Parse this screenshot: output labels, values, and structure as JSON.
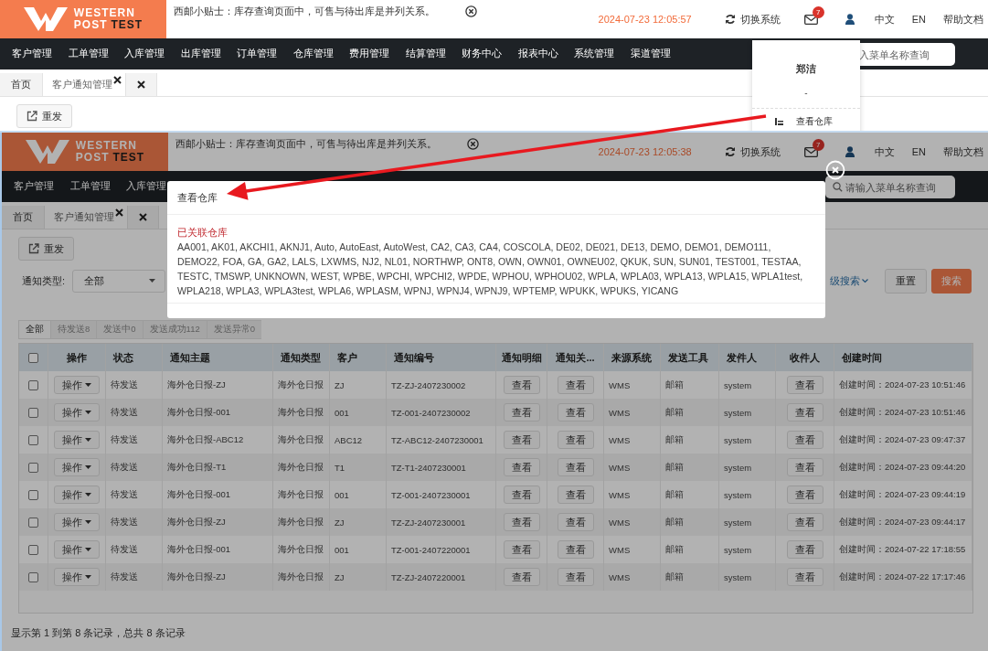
{
  "top_screen": {
    "header": {
      "logo_words": [
        "WESTERN",
        "POST",
        "TEST"
      ],
      "tip": "西邮小贴士：库存查询页面中，可售与待出库是并列关系。",
      "datetime": "2024-07-23 12:05:57",
      "switch_system": "切换系统",
      "mail_badge": "7",
      "languages": [
        "中文",
        "EN"
      ],
      "help": "帮助文档"
    },
    "nav": {
      "items": [
        "客户管理",
        "工单管理",
        "入库管理",
        "出库管理",
        "订单管理",
        "仓库管理",
        "费用管理",
        "结算管理",
        "财务中心",
        "报表中心",
        "系统管理",
        "渠道管理"
      ],
      "search_placeholder": "入菜单名称查询"
    },
    "tabs": [
      {
        "label": "首页",
        "selected": false,
        "closable": false
      },
      {
        "label": "客户通知管理",
        "selected": true,
        "closable": true
      },
      {
        "selected": false,
        "closable": true
      }
    ],
    "resend_button": "重发",
    "user_menu": {
      "name": "郑洁",
      "subtitle": "-",
      "items": [
        "查看仓库"
      ]
    }
  },
  "bottom_screen": {
    "header": {
      "logo_words": [
        "WESTERN",
        "POST",
        "TEST"
      ],
      "tip": "西邮小贴士：库存查询页面中，可售与待出库是并列关系。",
      "datetime": "2024-07-23 12:05:38",
      "switch_system": "切换系统",
      "mail_badge": "7",
      "languages": [
        "中文",
        "EN"
      ],
      "help": "帮助文档"
    },
    "nav": {
      "items": [
        "客户管理",
        "工单管理",
        "入库管理"
      ],
      "search_placeholder": "请输入菜单名称查询"
    },
    "tabs": [
      {
        "label": "首页",
        "selected": false,
        "closable": false
      },
      {
        "label": "客户通知管理",
        "selected": true,
        "closable": true
      },
      {
        "selected": false,
        "closable": true
      }
    ],
    "resend_button": "重发",
    "filter": {
      "label": "通知类型:",
      "value": "全部",
      "advanced_search": "级搜索",
      "reset": "重置",
      "search": "搜索"
    },
    "status_tabs": [
      {
        "label": "全部",
        "selected": true
      },
      {
        "label": "待发送8",
        "selected": false
      },
      {
        "label": "发送中0",
        "selected": false
      },
      {
        "label": "发送成功112",
        "selected": false
      },
      {
        "label": "发送异常0",
        "selected": false
      }
    ],
    "table": {
      "select_all_checked": false,
      "columns": [
        {
          "label": "操作",
          "kind": "menu"
        },
        {
          "label": "状态",
          "kind": "text"
        },
        {
          "label": "通知主题",
          "kind": "text"
        },
        {
          "label": "通知类型",
          "kind": "text"
        },
        {
          "label": "客户",
          "kind": "text"
        },
        {
          "label": "通知编号",
          "kind": "text"
        },
        {
          "label": "通知明细",
          "kind": "button"
        },
        {
          "label": "通知关...",
          "kind": "button"
        },
        {
          "label": "来源系统",
          "kind": "text"
        },
        {
          "label": "发送工具",
          "kind": "text"
        },
        {
          "label": "发件人",
          "kind": "text"
        },
        {
          "label": "收件人",
          "kind": "button"
        },
        {
          "label": "创建时间",
          "kind": "text"
        }
      ],
      "rows": [
        {
          "checked": false,
          "cells": [
            "操作",
            "待发送",
            "海外仓日报-ZJ",
            "海外仓日报",
            "ZJ",
            "TZ-ZJ-2407230002",
            "查看",
            "查看",
            "WMS",
            "邮箱",
            "system",
            "查看",
            "创建时间：2024-07-23 10:51:46"
          ]
        },
        {
          "checked": false,
          "cells": [
            "操作",
            "待发送",
            "海外仓日报-001",
            "海外仓日报",
            "001",
            "TZ-001-2407230002",
            "查看",
            "查看",
            "WMS",
            "邮箱",
            "system",
            "查看",
            "创建时间：2024-07-23 10:51:46"
          ]
        },
        {
          "checked": false,
          "cells": [
            "操作",
            "待发送",
            "海外仓日报-ABC12",
            "海外仓日报",
            "ABC12",
            "TZ-ABC12-2407230001",
            "查看",
            "查看",
            "WMS",
            "邮箱",
            "system",
            "查看",
            "创建时间：2024-07-23 09:47:37"
          ]
        },
        {
          "checked": false,
          "cells": [
            "操作",
            "待发送",
            "海外仓日报-T1",
            "海外仓日报",
            "T1",
            "TZ-T1-2407230001",
            "查看",
            "查看",
            "WMS",
            "邮箱",
            "system",
            "查看",
            "创建时间：2024-07-23 09:44:20"
          ]
        },
        {
          "checked": false,
          "cells": [
            "操作",
            "待发送",
            "海外仓日报-001",
            "海外仓日报",
            "001",
            "TZ-001-2407230001",
            "查看",
            "查看",
            "WMS",
            "邮箱",
            "system",
            "查看",
            "创建时间：2024-07-23 09:44:19"
          ]
        },
        {
          "checked": false,
          "cells": [
            "操作",
            "待发送",
            "海外仓日报-ZJ",
            "海外仓日报",
            "ZJ",
            "TZ-ZJ-2407230001",
            "查看",
            "查看",
            "WMS",
            "邮箱",
            "system",
            "查看",
            "创建时间：2024-07-23 09:44:17"
          ]
        },
        {
          "checked": false,
          "cells": [
            "操作",
            "待发送",
            "海外仓日报-001",
            "海外仓日报",
            "001",
            "TZ-001-2407220001",
            "查看",
            "查看",
            "WMS",
            "邮箱",
            "system",
            "查看",
            "创建时间：2024-07-22 17:18:55"
          ]
        },
        {
          "checked": false,
          "cells": [
            "操作",
            "待发送",
            "海外仓日报-ZJ",
            "海外仓日报",
            "ZJ",
            "TZ-ZJ-2407220001",
            "查看",
            "查看",
            "WMS",
            "邮箱",
            "system",
            "查看",
            "创建时间：2024-07-22 17:17:46"
          ]
        }
      ]
    },
    "footer": "显示第 1 到第 8 条记录，总共 8 条记录"
  },
  "modal": {
    "title": "查看仓库",
    "section_label": "已关联仓库",
    "warehouses": "AA001, AK01, AKCHI1, AKNJ1, Auto, AutoEast, AutoWest, CA2, CA3, CA4, COSCOLA, DE02, DE021, DE13, DEMO, DEMO1, DEMO111, DEMO22, FOA, GA, GA2, LALS, LXWMS, NJ2, NL01, NORTHWP, ONT8, OWN, OWN01, OWNEU02, QKUK, SUN, SUN01, TEST001, TESTAA, TESTC, TMSWP, UNKNOWN, WEST, WPBE, WPCHI, WPCHI2, WPDE, WPHOU, WPHOU02, WPLA, WPLA03, WPLA13, WPLA15, WPLA1test, WPLA218, WPLA3, WPLA3test, WPLA6, WPLASM, WPNJ, WPNJ4, WPNJ9, WPTEMP, WPUKK, WPUKS, YICANG"
  }
}
